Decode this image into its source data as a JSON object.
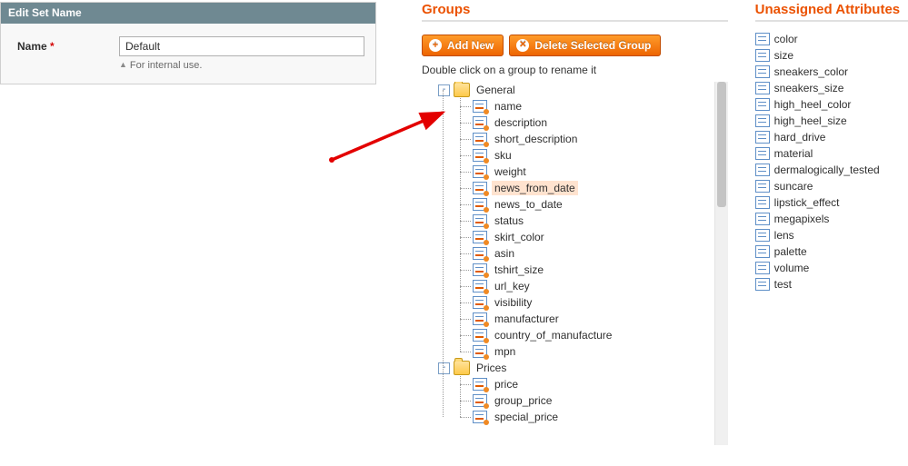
{
  "editSet": {
    "header": "Edit Set Name",
    "nameLabel": "Name",
    "required": "*",
    "value": "Default",
    "hint": "For internal use."
  },
  "groups": {
    "title": "Groups",
    "addBtn": "Add New",
    "deleteBtn": "Delete Selected Group",
    "hint": "Double click on a group to rename it",
    "folders": [
      {
        "label": "General",
        "items": [
          {
            "label": "name"
          },
          {
            "label": "description"
          },
          {
            "label": "short_description"
          },
          {
            "label": "sku"
          },
          {
            "label": "weight"
          },
          {
            "label": "news_from_date",
            "highlight": true
          },
          {
            "label": "news_to_date"
          },
          {
            "label": "status"
          },
          {
            "label": "skirt_color"
          },
          {
            "label": "asin"
          },
          {
            "label": "tshirt_size"
          },
          {
            "label": "url_key"
          },
          {
            "label": "visibility"
          },
          {
            "label": "manufacturer"
          },
          {
            "label": "country_of_manufacture"
          },
          {
            "label": "mpn"
          }
        ]
      },
      {
        "label": "Prices",
        "items": [
          {
            "label": "price"
          },
          {
            "label": "group_price"
          },
          {
            "label": "special_price"
          }
        ]
      }
    ]
  },
  "unassigned": {
    "title": "Unassigned Attributes",
    "items": [
      "color",
      "size",
      "sneakers_color",
      "sneakers_size",
      "high_heel_color",
      "high_heel_size",
      "hard_drive",
      "material",
      "dermalogically_tested",
      "suncare",
      "lipstick_effect",
      "megapixels",
      "lens",
      "palette",
      "volume",
      "test"
    ]
  }
}
